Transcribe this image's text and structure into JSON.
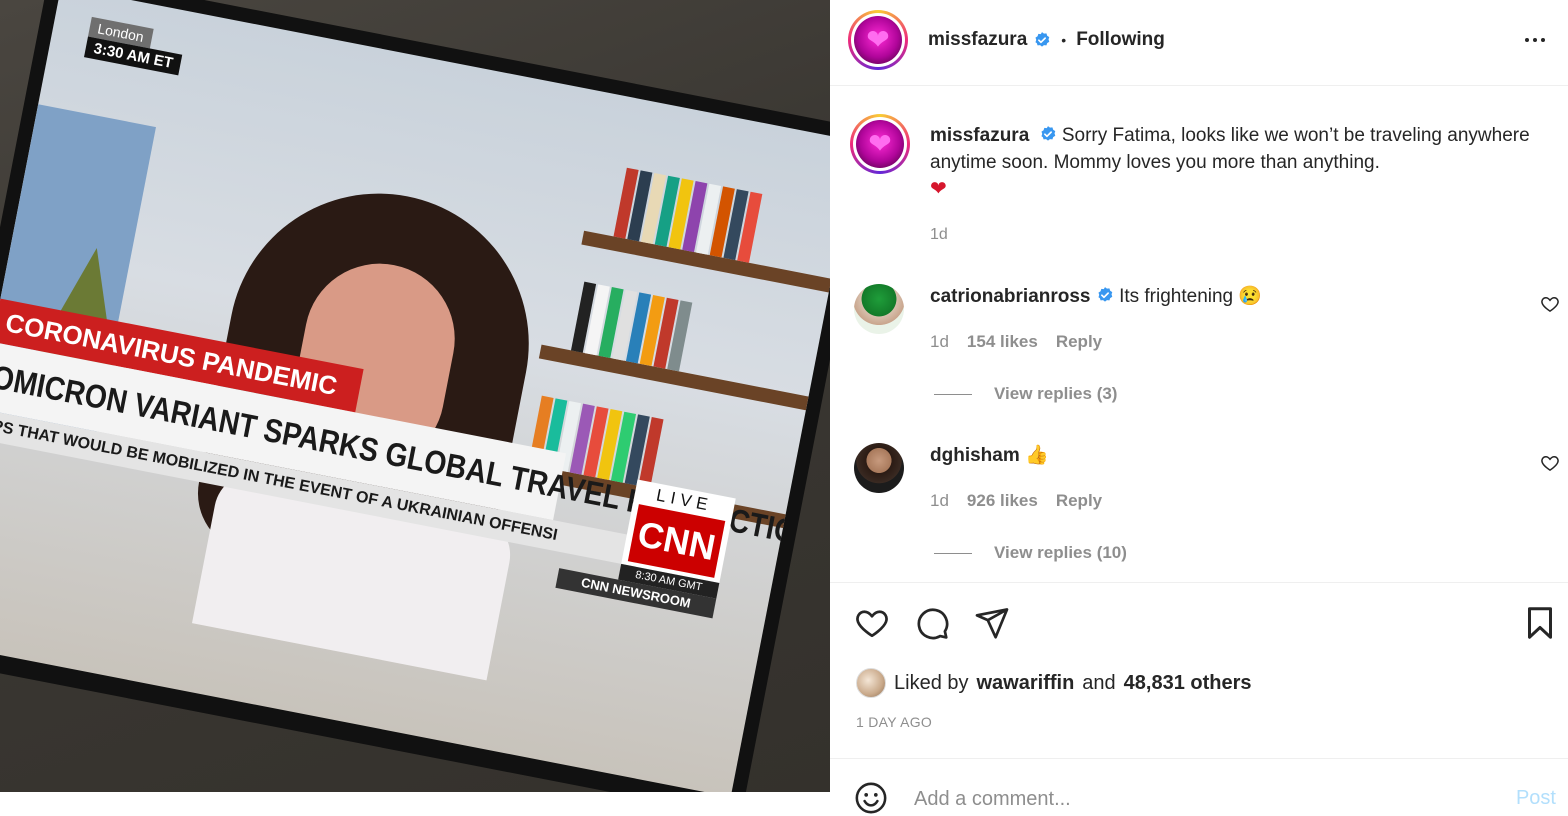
{
  "photo": {
    "tv_location": "London",
    "tv_time": "3:30 AM ET",
    "tv_category": "CORONAVIRUS PANDEMIC",
    "tv_headline": "OMICRON VARIANT SPARKS GLOBAL TRAVEL RESTRICTIONS",
    "tv_ticker": "OPS THAT WOULD BE MOBILIZED IN THE EVENT OF A UKRAINIAN OFFENSI",
    "tv_live": "LIVE",
    "tv_network": "CNN",
    "tv_gmt": "8:30 AM GMT",
    "tv_program": "CNN NEWSROOM"
  },
  "header": {
    "username": "missfazura",
    "separator": "•",
    "follow_status": "Following"
  },
  "caption": {
    "username": "missfazura",
    "text": "Sorry Fatima, looks like we won’t be traveling anywhere anytime soon. Mommy loves you more than anything.",
    "emoji": "❤",
    "time": "1d"
  },
  "comments": [
    {
      "username": "catrionabrianross",
      "text": "Its frightening",
      "emoji": "😢",
      "time": "1d",
      "likes": "154 likes",
      "reply_label": "Reply",
      "view_replies": "View replies (3)"
    },
    {
      "username": "dghisham",
      "text": "",
      "emoji": "👍",
      "time": "1d",
      "likes": "926 likes",
      "reply_label": "Reply",
      "view_replies": "View replies (10)"
    }
  ],
  "likes": {
    "prefix": "Liked by",
    "user": "wawariffin",
    "conjunction": "and",
    "others": "48,831 others"
  },
  "post_date": "1 DAY AGO",
  "comment_box": {
    "placeholder": "Add a comment...",
    "post_label": "Post"
  },
  "colors": {
    "verified": "#3897f0",
    "muted": "#8e8e8e",
    "post_disabled": "#b2dffc"
  }
}
